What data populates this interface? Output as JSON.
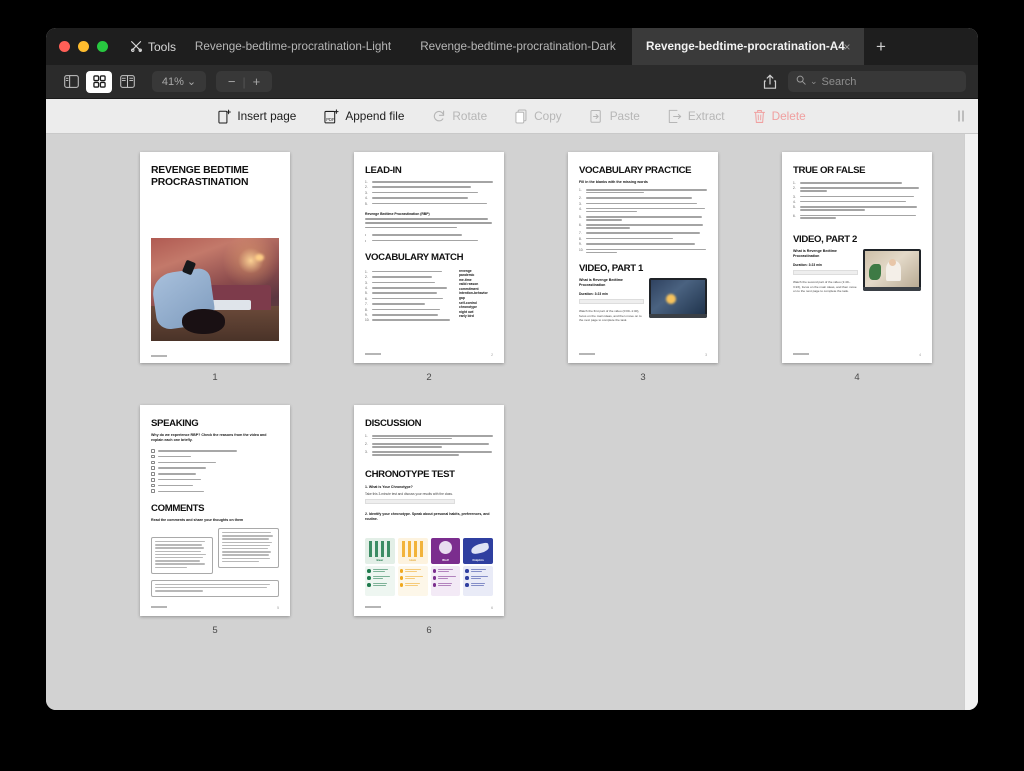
{
  "window": {
    "traffic_lights": [
      "close",
      "minimize",
      "maximize"
    ],
    "tools_label": "Tools",
    "new_tab_label": "+",
    "tabs": [
      {
        "label": "Revenge-bedtime-procratination-Light",
        "active": false
      },
      {
        "label": "Revenge-bedtime-procratination-Dark",
        "active": false
      },
      {
        "label": "Revenge-bedtime-procratination-A4",
        "active": true,
        "close_label": "×"
      }
    ]
  },
  "toolbar": {
    "view_sidebar_icon": "sidebar-icon",
    "view_grid_icon": "grid-view-icon",
    "view_split_icon": "split-view-icon",
    "zoom_level": "41%",
    "zoom_caret": "⌄",
    "zoom_out_label": "−",
    "zoom_divider": "|",
    "zoom_in_label": "+",
    "share_icon": "share-icon",
    "search_icon": "search-icon",
    "search_caret": "⌄",
    "search_placeholder": "Search",
    "search_value": ""
  },
  "actionbar": {
    "actions": [
      {
        "id": "insert-page",
        "label": "Insert page",
        "disabled": false
      },
      {
        "id": "append-file",
        "label": "Append file",
        "disabled": false
      },
      {
        "id": "rotate",
        "label": "Rotate",
        "disabled": true
      },
      {
        "id": "copy",
        "label": "Copy",
        "disabled": true
      },
      {
        "id": "paste",
        "label": "Paste",
        "disabled": true
      },
      {
        "id": "extract",
        "label": "Extract",
        "disabled": true
      },
      {
        "id": "delete",
        "label": "Delete",
        "disabled": true
      }
    ],
    "grip_label": "resize-grip"
  },
  "document": {
    "page_count": 6,
    "pages": [
      {
        "number": "1",
        "kind": "cover",
        "title": "REVENGE BEDTIME PROCRASTINATION",
        "photo_alt": "person lying on floor at night using a phone",
        "footer_page": ""
      },
      {
        "number": "2",
        "kind": "text",
        "headings": [
          "LEAD-IN",
          "VOCABULARY MATCH"
        ],
        "definition_term": "Revenge Bedtime Procrastination (RBP)",
        "vocabulary_words": [
          "revenge",
          "pandemic",
          "me-time",
          "valid reason",
          "commitment",
          "intention-behavior gap",
          "self-control",
          "chronotype",
          "night owl",
          "early bird"
        ],
        "footer_page": "2"
      },
      {
        "number": "3",
        "kind": "text",
        "headings": [
          "VOCABULARY PRACTICE",
          "VIDEO, PART 1"
        ],
        "instruction": "Fill in the blanks with the missing words",
        "video_title": "What is Revenge Bedtime Procrastination",
        "video_duration": "Duration: 3:23 min",
        "video_task": "Watch the first part of the video (0:00–1:40), focus on the main ideas, and then move on to the next page to complete the task.",
        "footer_page": "3"
      },
      {
        "number": "4",
        "kind": "text",
        "headings": [
          "TRUE OR FALSE",
          "VIDEO, PART 2"
        ],
        "video_title": "What is Revenge Bedtime Procrastination",
        "video_duration": "Duration: 3:23 min",
        "video_task": "Watch the second part of the video (1:40–3:23), focus on the main ideas, and then move on to the next page to complete the task.",
        "footer_page": "4"
      },
      {
        "number": "5",
        "kind": "text",
        "headings": [
          "SPEAKING",
          "COMMENTS"
        ],
        "instruction": "Why do we experience RBP? Check the reasons from the video and explain each one briefly.",
        "checkbox_count": 8,
        "comments_instruction": "Read the comments and share your thoughts on them",
        "comment_count": 3,
        "footer_page": "5"
      },
      {
        "number": "6",
        "kind": "text",
        "headings": [
          "DISCUSSION",
          "CHRONOTYPE TEST"
        ],
        "sub_q1": "1. What is Your Chronotype?",
        "sub_q1_text": "Take this 3-minute test and discuss your results with the class.",
        "sub_q2": "2. Identify your chronotype. Speak about personal habits, preferences, and routine.",
        "chronotypes": [
          {
            "name": "Bear",
            "color": "#1f7a4d",
            "tint": "#e8f3ec"
          },
          {
            "name": "Lion",
            "color": "#f0a81e",
            "tint": "#fdf5e3"
          },
          {
            "name": "Wolf",
            "color": "#7b2d8e",
            "tint": "#f3eaf6"
          },
          {
            "name": "Dolphin",
            "color": "#2f3fa0",
            "tint": "#e9ebf7"
          }
        ],
        "footer_page": "6"
      }
    ]
  },
  "colors": {
    "window_bg": "#d2d2d2",
    "tabbar_bg": "#1e1e1e",
    "toolbar_bg": "#2b2b2b",
    "actionbar_bg": "#ececec",
    "active_tab_bg": "#3a3a3a",
    "delete_red": "#f0a0a0"
  }
}
